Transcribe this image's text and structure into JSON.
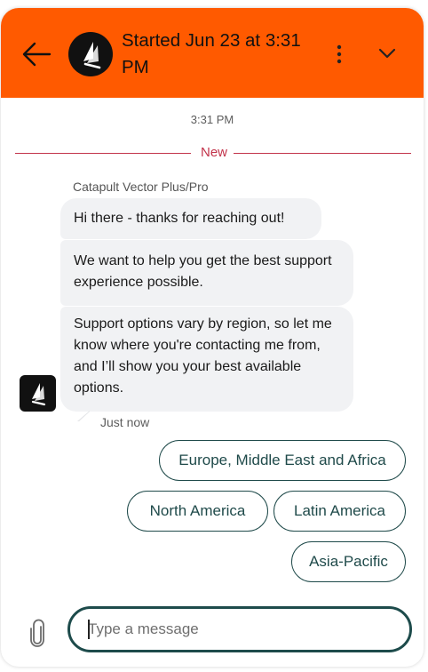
{
  "header": {
    "title": "Started Jun 23 at 3:31 PM",
    "brand_color": "#ff5a00",
    "back_icon": "arrow-left-icon",
    "more_icon": "vertical-ellipsis-icon",
    "collapse_icon": "chevron-down-icon"
  },
  "conversation": {
    "timestamp": "3:31 PM",
    "new_divider_label": "New",
    "agent_name": "Catapult Vector Plus/Pro",
    "messages": [
      "Hi there - thanks for reaching out!",
      "We want to help you get the best support experience possible.",
      "Support options vary by region, so let me know where you're contacting me from, and I’ll show you your best available options."
    ],
    "sent_time": "Just now"
  },
  "options": [
    "Europe, Middle East and Africa",
    "North America",
    "Latin America",
    "Asia-Pacific"
  ],
  "composer": {
    "placeholder": "Type a message",
    "attach_icon": "paperclip-icon"
  }
}
